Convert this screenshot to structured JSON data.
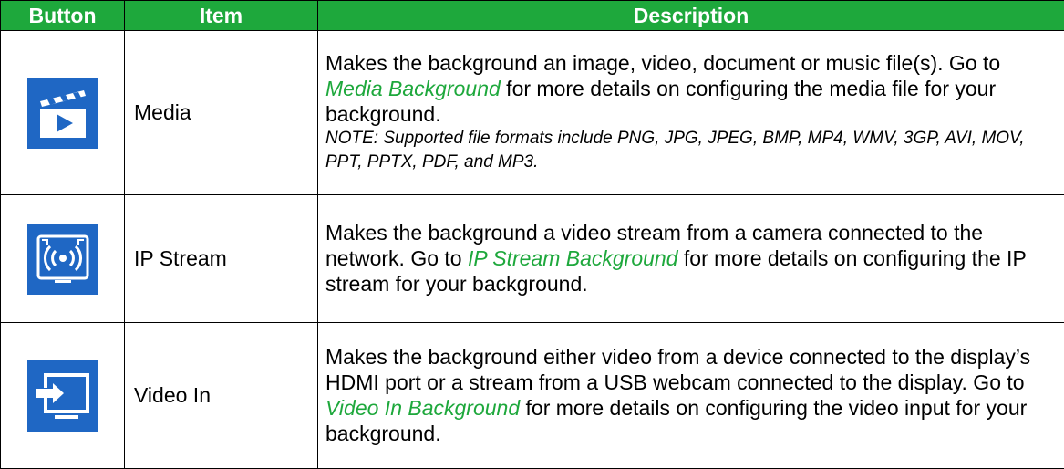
{
  "colors": {
    "header_bg": "#1ea83c",
    "header_text": "#ffffff",
    "link": "#1ea83c",
    "icon_bg": "#1f67c4",
    "icon_fg": "#ffffff"
  },
  "table": {
    "headers": {
      "button": "Button",
      "item": "Item",
      "description": "Description"
    },
    "rows": [
      {
        "icon": "media-clapperboard-play-icon",
        "item": "Media",
        "desc_before": "Makes the background an image, video, document or music file(s). Go to ",
        "desc_link": "Media Background",
        "desc_after": " for more details on configuring the media file for your background.",
        "note": "NOTE: Supported file formats include PNG, JPG, JPEG, BMP, MP4, WMV, 3GP, AVI, MOV, PPT, PPTX, PDF, and MP3."
      },
      {
        "icon": "ip-stream-broadcast-icon",
        "item": "IP Stream",
        "desc_before": "Makes the background a video stream from a camera connected to the network. Go to ",
        "desc_link": "IP Stream Background",
        "desc_after": " for more details on configuring the IP stream for your background."
      },
      {
        "icon": "video-in-input-arrow-icon",
        "item": "Video In",
        "desc_before": "Makes the background either video from a device connected to the display’s HDMI port or a stream from a USB webcam connected to the display. Go to ",
        "desc_link": "Video In Background",
        "desc_after": " for more details on configuring the video input for your background."
      }
    ]
  }
}
